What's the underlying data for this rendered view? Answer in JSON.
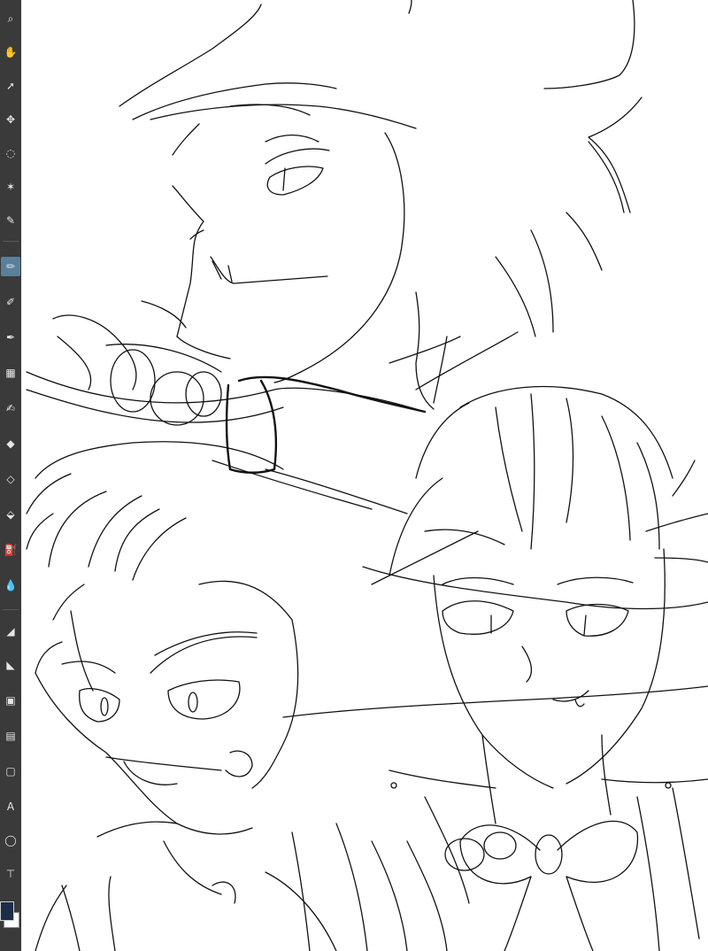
{
  "toolbar": {
    "tools": [
      {
        "name": "zoom-tool",
        "glyph": "⌕"
      },
      {
        "name": "hand-tool",
        "glyph": "✋"
      },
      {
        "name": "object-tool",
        "glyph": "➚"
      },
      {
        "name": "move-tool",
        "glyph": "✥"
      },
      {
        "name": "lasso-tool",
        "glyph": "◌"
      },
      {
        "name": "magic-wand-tool",
        "glyph": "✶"
      },
      {
        "name": "eyedropper-tool",
        "glyph": "✎"
      },
      {
        "name": "pen-tool",
        "glyph": "✏"
      },
      {
        "name": "pencil-tool",
        "glyph": "✐"
      },
      {
        "name": "brush-tool",
        "glyph": "✒"
      },
      {
        "name": "airbrush-tool",
        "glyph": "▦"
      },
      {
        "name": "decoration-tool",
        "glyph": "✍"
      },
      {
        "name": "eraser-tool",
        "glyph": "◆"
      },
      {
        "name": "blend-tool",
        "glyph": "◇"
      },
      {
        "name": "fill-tool",
        "glyph": "⬙"
      },
      {
        "name": "bucket-tool",
        "glyph": "⛽"
      },
      {
        "name": "drop-tool",
        "glyph": "💧"
      },
      {
        "name": "gradient-tool",
        "glyph": "◢"
      },
      {
        "name": "figure-tool",
        "glyph": "◣"
      },
      {
        "name": "frame-tool",
        "glyph": "▣"
      },
      {
        "name": "sticky-tool",
        "glyph": "▤"
      },
      {
        "name": "panel-tool",
        "glyph": "▢"
      },
      {
        "name": "text-tool",
        "glyph": "A"
      },
      {
        "name": "balloon-tool",
        "glyph": "◯"
      },
      {
        "name": "ruler-tool",
        "glyph": "⊤"
      }
    ]
  },
  "colors": {
    "toolbar_bg": "#3a3a3a",
    "active_tool": "#5a7f9a",
    "foreground_color": "#1c2d4a",
    "background_color": "#ffffff",
    "ink": "#111111"
  }
}
